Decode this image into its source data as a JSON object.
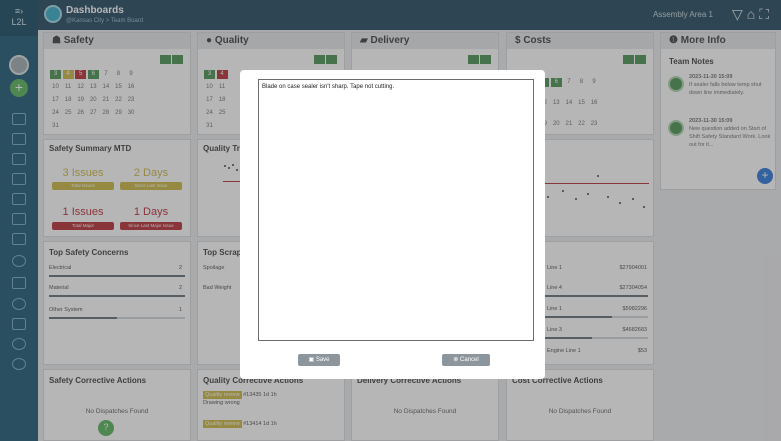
{
  "app": {
    "sidebar_label": "L2L",
    "title": "Dashboards",
    "breadcrumb": "@Kansas City > Team Board",
    "area": "Assembly Area 1"
  },
  "colors": {
    "header": "#163e56",
    "sidebar": "#0e4e6c",
    "green": "#3f8c48",
    "yellow": "#c9b33a",
    "red": "#b2222a"
  },
  "icons": [
    "menu-icon",
    "home-icon",
    "filter-icon",
    "fullscreen-icon",
    "shield-icon",
    "check-circle-icon",
    "truck-icon",
    "dollar-icon",
    "info-icon"
  ],
  "panels": {
    "safety": "Safety",
    "quality": "Quality",
    "delivery": "Delivery",
    "costs": "$ Costs",
    "more_info": "More Info"
  },
  "calendar_rows": [
    [
      "",
      "",
      "",
      "",
      "",
      "7",
      "8",
      "9"
    ],
    [
      "10",
      "11",
      "12",
      "13",
      "14",
      "15",
      "16"
    ],
    [
      "17",
      "18",
      "19",
      "20",
      "21",
      "22",
      "23"
    ],
    [
      "24",
      "25",
      "26",
      "27",
      "28",
      "29",
      "30"
    ],
    [
      "31"
    ]
  ],
  "safety_summary": {
    "title": "Safety Summary MTD",
    "kpis": [
      {
        "value": "3 Issues",
        "label": "Total Issues"
      },
      {
        "value": "2 Days",
        "label": "Since Last Issue"
      },
      {
        "value": "1 Issues",
        "label": "Total Major"
      },
      {
        "value": "1 Days",
        "label": "Since Last Major Issue"
      }
    ]
  },
  "quality_trend": {
    "title": "Quality Tre"
  },
  "top_safety": {
    "title": "Top Safety Concerns",
    "rows": [
      {
        "label": "Electrical",
        "value": "2"
      },
      {
        "label": "Material",
        "value": "2"
      },
      {
        "label": "Other System",
        "value": "1"
      }
    ]
  },
  "top_scrap": {
    "title": "Top Scrap",
    "rows": [
      {
        "label": "Spoilage",
        "value": "3"
      },
      {
        "label": "Bad Weight",
        "value": "1"
      }
    ]
  },
  "costs_list": {
    "rows": [
      {
        "label": "Line 1",
        "value": "$27904001"
      },
      {
        "label": "Line 4",
        "value": "$27304054"
      },
      {
        "label": "Line 1",
        "value": "$5982296"
      },
      {
        "label": "Line 3",
        "value": "$4682683"
      },
      {
        "label": "Engine Line 1",
        "value": "$53"
      }
    ]
  },
  "corrective": {
    "safety": "Safety Corrective Actions",
    "quality": "Quality Corrective Actions",
    "delivery": "Delivery Corrective Actions",
    "cost": "Cost Corrective Actions",
    "no_dispatches": "No Dispatches Found",
    "q_items": [
      {
        "badge": "Quality review",
        "id": "#13435",
        "time": "1d 1h",
        "name": "Drawing wrong"
      },
      {
        "badge": "Quality review",
        "id": "#13414",
        "time": "1d 1h",
        "name": ""
      }
    ]
  },
  "team_notes": {
    "title": "Team Notes",
    "items": [
      {
        "date": "2023-11-30 15:09",
        "text": "If sealer falls below temp shut down line immediately."
      },
      {
        "date": "2023-11-30 15:09",
        "text": "New question added on Start of Shift Safety Standard Work. Look out for it..."
      }
    ]
  },
  "modal": {
    "text": "Blade on case sealer isn't sharp. Tape not cutting.",
    "save": "Save",
    "cancel": "Cancel"
  }
}
